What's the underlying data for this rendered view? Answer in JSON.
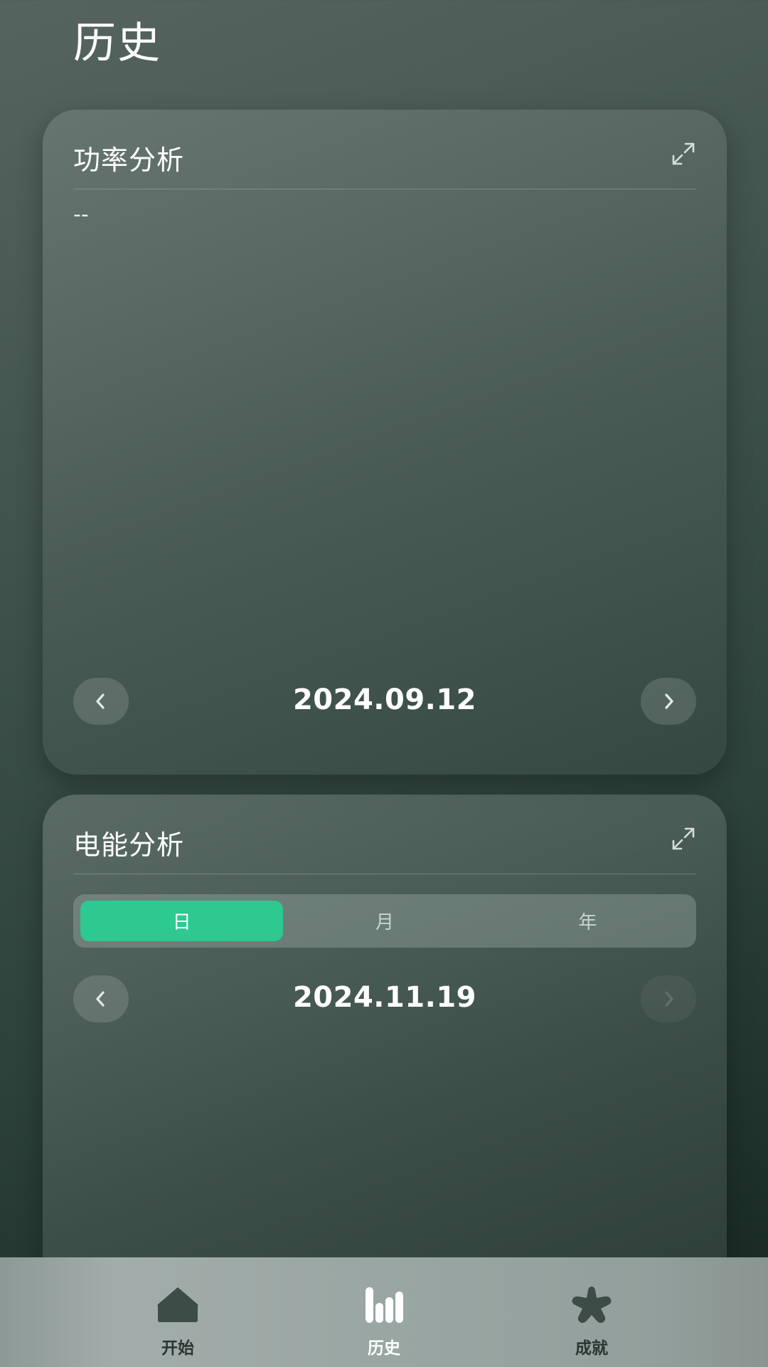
{
  "header": {
    "title": "历史"
  },
  "power_card": {
    "title": "功率分析",
    "empty_text": "--",
    "date": "2024.09.12"
  },
  "energy_card": {
    "title": "电能分析",
    "segments": [
      {
        "label": "日",
        "active": true
      },
      {
        "label": "月",
        "active": false
      },
      {
        "label": "年",
        "active": false
      }
    ],
    "date": "2024.11.19"
  },
  "tabbar": {
    "items": [
      {
        "label": "开始",
        "icon": "home-icon",
        "active": false
      },
      {
        "label": "历史",
        "icon": "bar-chart-icon",
        "active": true
      },
      {
        "label": "成就",
        "icon": "star-icon",
        "active": false
      }
    ]
  },
  "colors": {
    "accent": "#2ec891",
    "tab_inactive": "#3e4c48",
    "tab_active": "#ffffff"
  }
}
